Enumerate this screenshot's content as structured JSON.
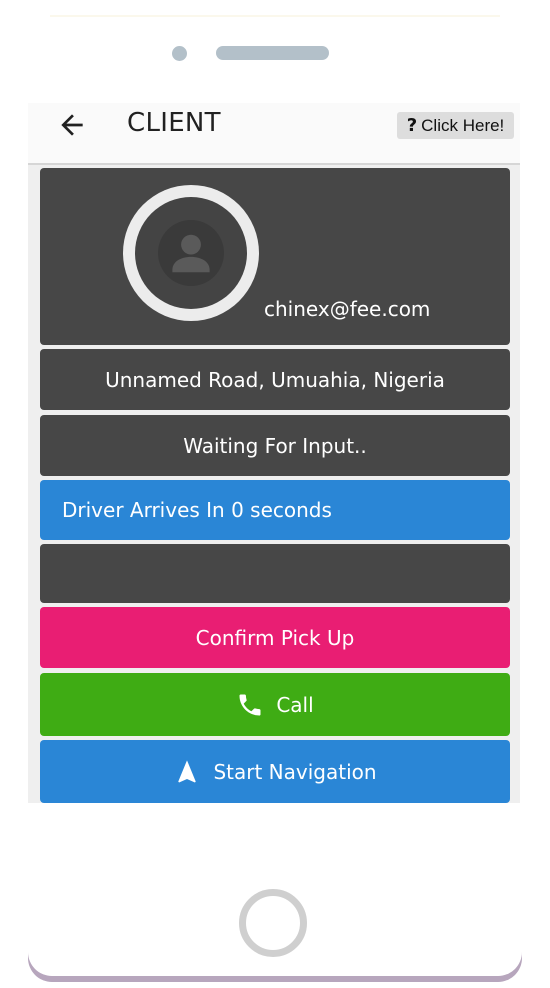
{
  "app": {
    "title": "CLIENT",
    "help_label": "Click Here!",
    "help_glyph": "?"
  },
  "profile": {
    "email": "chinex@fee.com"
  },
  "info": {
    "address": "Unnamed Road, Umuahia, Nigeria",
    "status": "Waiting For Input..",
    "eta": "Driver Arrives In 0 seconds",
    "empty_panel": ""
  },
  "actions": {
    "confirm_label": "Confirm Pick Up",
    "call_label": "Call",
    "navigation_label": "Start Navigation"
  },
  "icons": {
    "back": "arrow-left-icon",
    "help": "question-mark-icon",
    "avatar": "user-avatar-icon",
    "call": "phone-icon",
    "navigation": "navigation-arrow-icon"
  },
  "colors": {
    "dark_card": "#474747",
    "blue": "#2a86d6",
    "pink": "#e91e73",
    "green": "#3fac14"
  }
}
